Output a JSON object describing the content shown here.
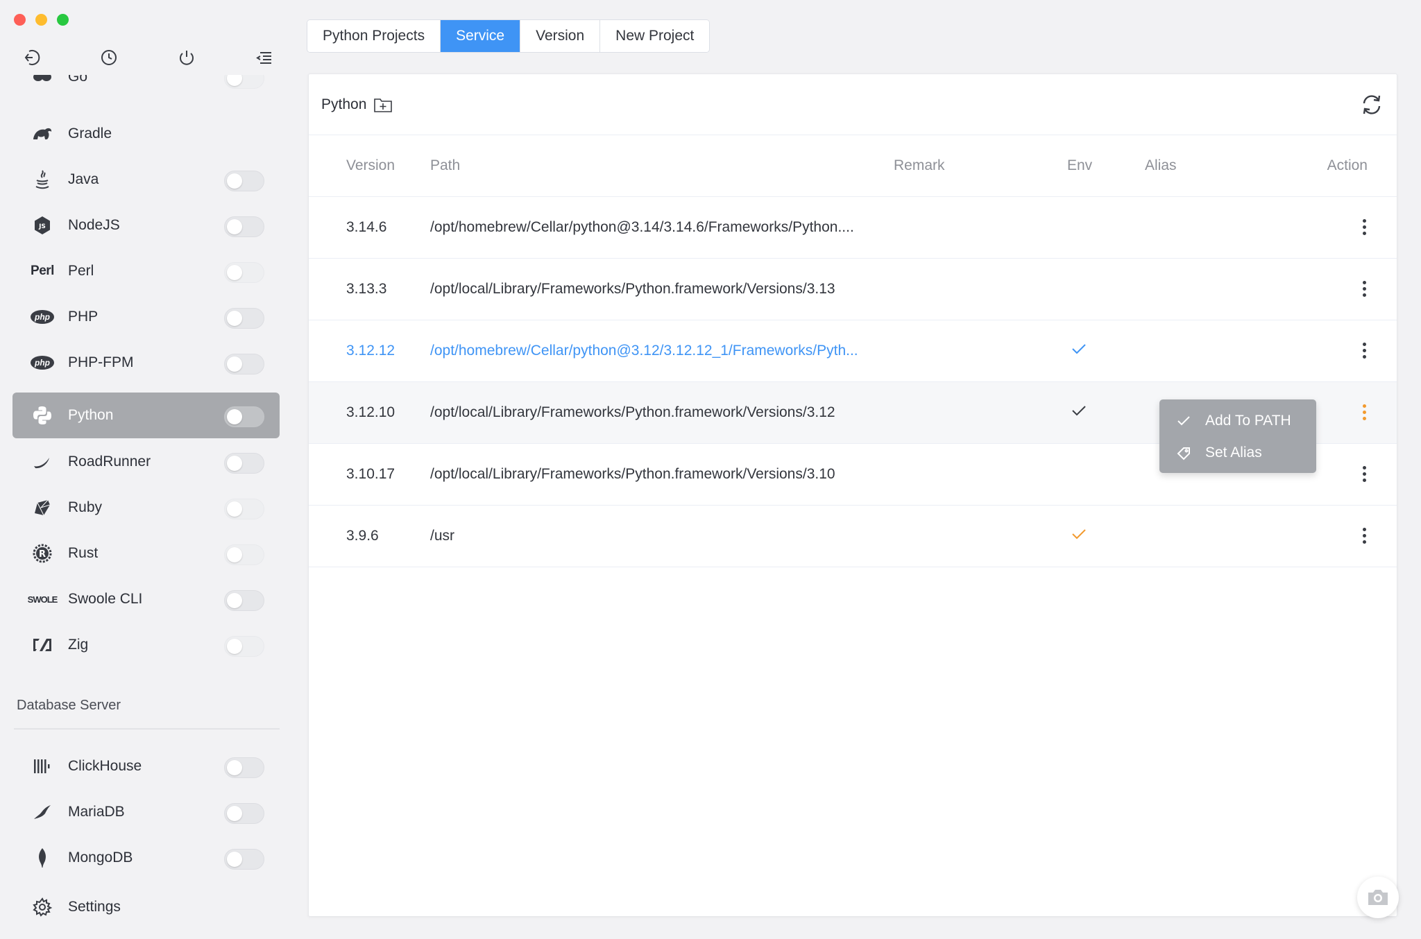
{
  "window": {
    "traffic_lights": [
      "close",
      "minimize",
      "zoom"
    ]
  },
  "sidebar": {
    "toolbar": [
      "back-icon",
      "history-icon",
      "power-icon",
      "menu-collapse-icon"
    ],
    "items": [
      {
        "label": "Go",
        "icon": "go-icon",
        "toggle": "off"
      },
      {
        "label": "Gradle",
        "icon": "gradle-icon",
        "toggle": "none"
      },
      {
        "label": "Java",
        "icon": "java-icon",
        "toggle": "off"
      },
      {
        "label": "NodeJS",
        "icon": "nodejs-icon",
        "toggle": "off"
      },
      {
        "label": "Perl",
        "icon_text": "Perl",
        "toggle": "off"
      },
      {
        "label": "PHP",
        "icon_text": "php",
        "toggle": "off"
      },
      {
        "label": "PHP-FPM",
        "icon_text": "php",
        "toggle": "off"
      },
      {
        "label": "Python",
        "icon": "python-icon",
        "toggle": "off",
        "active": true
      },
      {
        "label": "RoadRunner",
        "icon": "roadrunner-icon",
        "toggle": "off"
      },
      {
        "label": "Ruby",
        "icon": "ruby-icon",
        "toggle": "off"
      },
      {
        "label": "Rust",
        "icon": "rust-icon",
        "toggle": "off"
      },
      {
        "label": "Swoole CLI",
        "icon_text": "SWOLE",
        "toggle": "off"
      },
      {
        "label": "Zig",
        "icon": "zig-icon",
        "toggle": "off"
      }
    ],
    "section_title": "Database Server",
    "db_items": [
      {
        "label": "ClickHouse",
        "icon": "clickhouse-icon",
        "toggle": "off"
      },
      {
        "label": "MariaDB",
        "icon": "mariadb-icon",
        "toggle": "off"
      },
      {
        "label": "MongoDB",
        "icon": "mongodb-icon",
        "toggle": "off"
      }
    ],
    "settings_label": "Settings"
  },
  "tabs": [
    "Python Projects",
    "Service",
    "Version",
    "New Project"
  ],
  "active_tab": "Service",
  "panel": {
    "title": "Python",
    "columns": [
      "Version",
      "Path",
      "Remark",
      "Env",
      "Alias",
      "Action"
    ],
    "rows": [
      {
        "version": "3.14.6",
        "path": "/opt/homebrew/Cellar/python@3.14/3.14.6/Frameworks/Python....",
        "remark": "",
        "env": "",
        "alias": ""
      },
      {
        "version": "3.13.3",
        "path": "/opt/local/Library/Frameworks/Python.framework/Versions/3.13",
        "remark": "",
        "env": "",
        "alias": ""
      },
      {
        "version": "3.12.12",
        "path": "/opt/homebrew/Cellar/python@3.12/3.12.12_1/Frameworks/Pyth...",
        "remark": "",
        "env": "check-blue",
        "alias": "",
        "highlighted": true
      },
      {
        "version": "3.12.10",
        "path": "/opt/local/Library/Frameworks/Python.framework/Versions/3.12",
        "remark": "",
        "env": "check-dark",
        "alias": "",
        "hover": true
      },
      {
        "version": "3.10.17",
        "path": "/opt/local/Library/Frameworks/Python.framework/Versions/3.10",
        "remark": "",
        "env": "",
        "alias": ""
      },
      {
        "version": "3.9.6",
        "path": "/usr",
        "remark": "",
        "env": "check-orange",
        "alias": ""
      }
    ]
  },
  "context_menu": {
    "items": [
      {
        "label": "Add To PATH",
        "icon": "check-icon"
      },
      {
        "label": "Set Alias",
        "icon": "tag-icon"
      }
    ]
  },
  "colors": {
    "accent": "#3f94f5",
    "active_sidebar": "#a7a9ad",
    "orange": "#f29a2e",
    "menu_bg": "#a3a6ab"
  }
}
